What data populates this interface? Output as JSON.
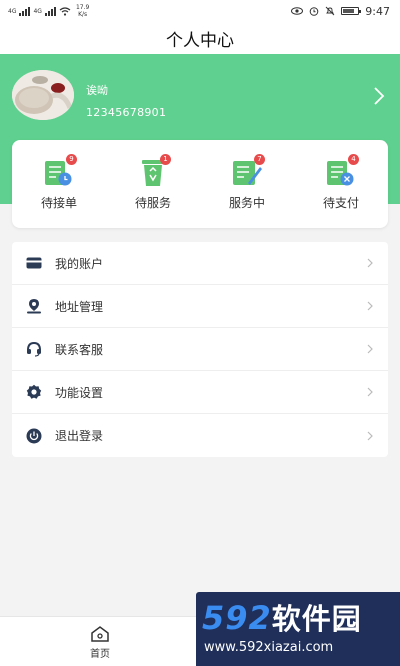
{
  "status_bar": {
    "network_1": "4G",
    "network_2": "4G",
    "speed_value": "17.9",
    "speed_unit": "K/s",
    "time": "9:47"
  },
  "header": {
    "title": "个人中心"
  },
  "profile": {
    "name": "诶呦",
    "phone": "12345678901"
  },
  "orders": [
    {
      "label": "待接单",
      "badge": "9"
    },
    {
      "label": "待服务",
      "badge": "1"
    },
    {
      "label": "服务中",
      "badge": "7"
    },
    {
      "label": "待支付",
      "badge": "4"
    }
  ],
  "menu": [
    {
      "label": "我的账户",
      "icon": "wallet-icon"
    },
    {
      "label": "地址管理",
      "icon": "location-icon"
    },
    {
      "label": "联系客服",
      "icon": "headset-icon"
    },
    {
      "label": "功能设置",
      "icon": "gear-icon"
    },
    {
      "label": "退出登录",
      "icon": "power-icon"
    }
  ],
  "tabbar": {
    "home_label": "首页"
  },
  "watermark": {
    "brand_num": "592",
    "brand_cn": "软件园",
    "url": "www.592xiazai.com"
  },
  "colors": {
    "accent": "#5fd08f",
    "badge": "#e84b4b",
    "icon_dark": "#2b3a55"
  }
}
